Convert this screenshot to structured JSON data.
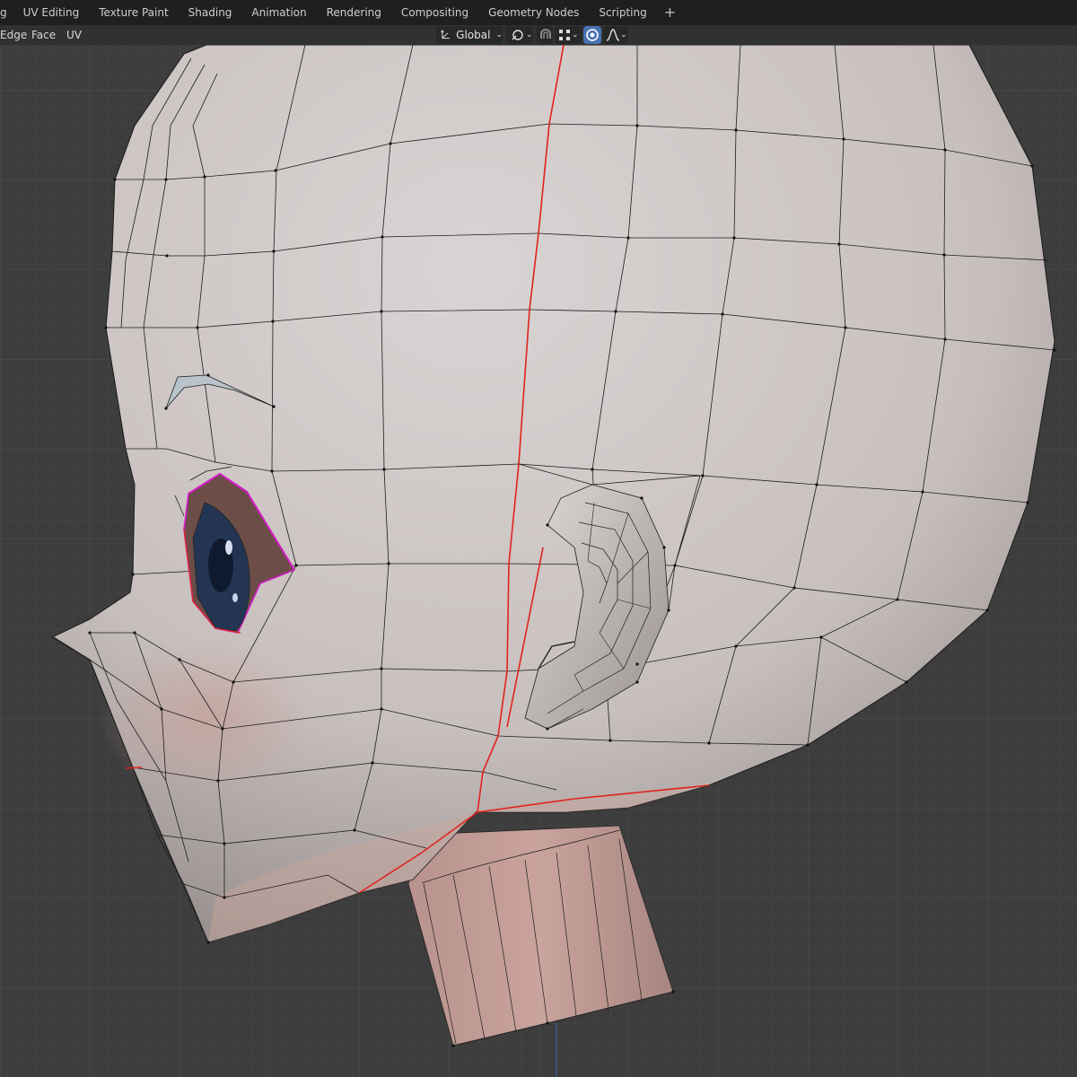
{
  "workspace_tabs": [
    {
      "label": "g"
    },
    {
      "label": "UV Editing"
    },
    {
      "label": "Texture Paint"
    },
    {
      "label": "Shading"
    },
    {
      "label": "Animation"
    },
    {
      "label": "Rendering"
    },
    {
      "label": "Compositing"
    },
    {
      "label": "Geometry Nodes"
    },
    {
      "label": "Scripting"
    }
  ],
  "header": {
    "menu": [
      {
        "label": "Edge"
      },
      {
        "label": "Face"
      },
      {
        "label": "UV"
      }
    ],
    "transform_orientation": "Global"
  },
  "colors": {
    "background": "#3d3d3d",
    "grid": "#474747",
    "mesh": "#d0c8c6",
    "neck": "#c9a19a",
    "seam": "#e0231c",
    "selection": "#d41cc8",
    "active_accent": "#5e8ee6"
  },
  "icons": [
    "transform-orientation-icon",
    "pivot-icon",
    "snap-icon",
    "snap-target-icon",
    "proportional-edit-icon",
    "falloff-icon",
    "add-workspace-icon"
  ]
}
